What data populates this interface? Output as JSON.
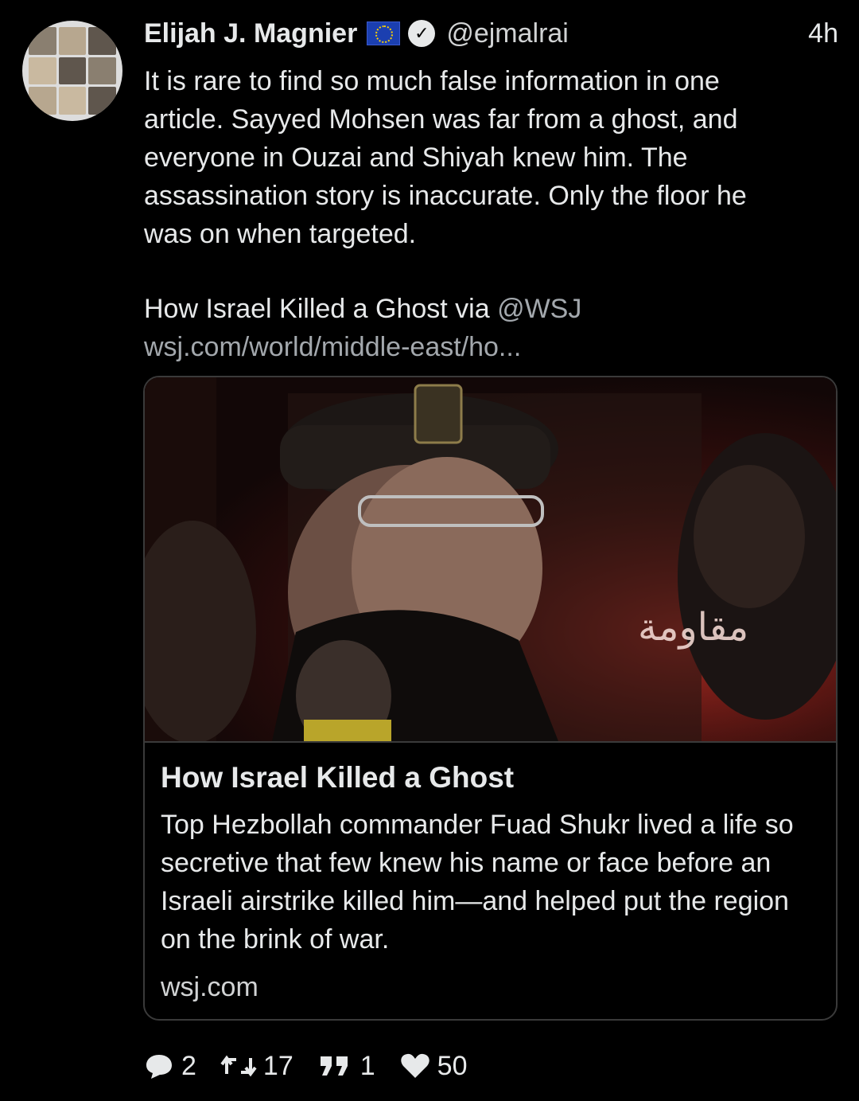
{
  "author": {
    "name": "Elijah J. Magnier",
    "handle": "@ejmalrai",
    "time": "4h",
    "flag_icon": "eu-flag-icon",
    "verified_icon": "verified-badge-icon"
  },
  "tweet": {
    "text": "It is rare to find so much false information in one\narticle. Sayyed Mohsen was far from a ghost, and\neveryone in Ouzai and Shiyah knew him. The\nassassination story is inaccurate.  Only the floor he\nwas on when targeted.",
    "via_prefix": "How Israel Killed a Ghost via ",
    "via_mention": "@WSJ",
    "link": "wsj.com/world/middle-east/ho..."
  },
  "card": {
    "image_banner_text": "مقاومة",
    "title": "How Israel Killed a Ghost",
    "description": "Top Hezbollah commander Fuad Shukr lived a life so secretive that few knew his name or face before an Israeli airstrike killed him—and helped put the region on the brink of war.",
    "domain": "wsj.com"
  },
  "actions": {
    "replies": "2",
    "retweets": "17",
    "quotes": "1",
    "likes": "50"
  },
  "colors": {
    "background": "#000000",
    "text": "#e7e9ea",
    "muted": "#a3a8ad",
    "border": "#3a3a3a"
  }
}
